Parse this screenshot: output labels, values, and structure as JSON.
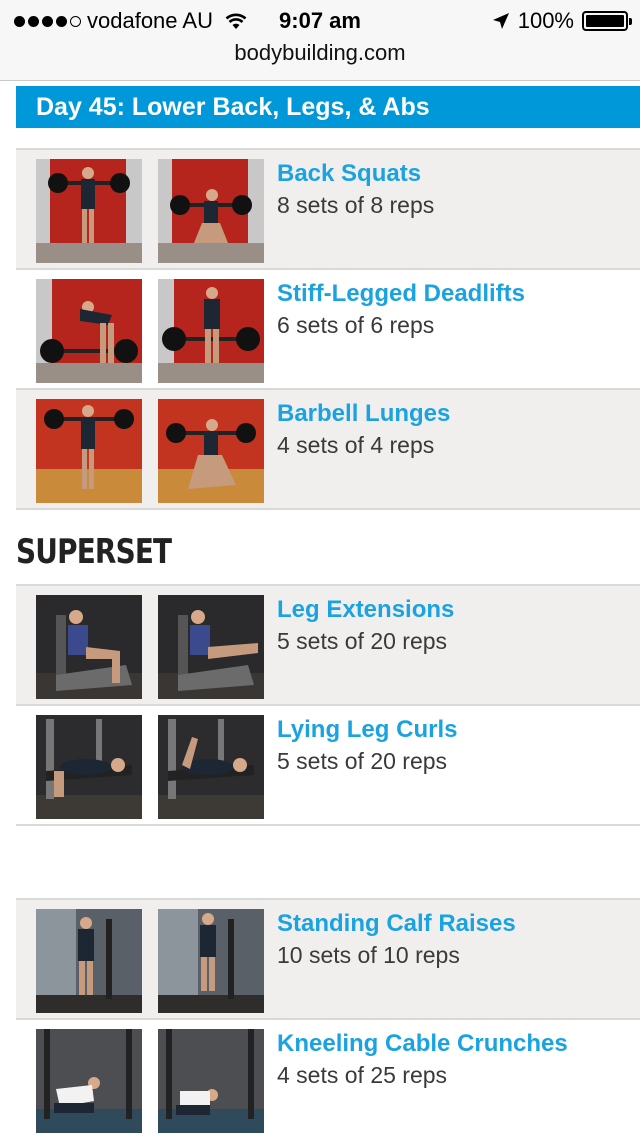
{
  "status_bar": {
    "carrier": "vodafone AU",
    "time": "9:07 am",
    "battery": "100%"
  },
  "url_bar": {
    "domain": "bodybuilding.com"
  },
  "day_title": "Day 45: Lower Back, Legs, & Abs",
  "section_superset": "SUPERSET",
  "exercises": [
    {
      "name": "Back Squats",
      "sets": "8 sets of 8 reps",
      "scene": "red"
    },
    {
      "name": "Stiff-Legged Deadlifts",
      "sets": "6 sets of 6 reps",
      "scene": "red"
    },
    {
      "name": "Barbell Lunges",
      "sets": "4 sets of 4 reps",
      "scene": "orange"
    },
    {
      "name": "Leg Extensions",
      "sets": "5 sets of 20 reps",
      "scene": "dark"
    },
    {
      "name": "Lying Leg Curls",
      "sets": "5 sets of 20 reps",
      "scene": "dark"
    },
    {
      "name": "Standing Calf Raises",
      "sets": "10 sets of 10 reps",
      "scene": "gym"
    },
    {
      "name": "Kneeling Cable Crunches",
      "sets": "4 sets of 25 reps",
      "scene": "gym"
    }
  ]
}
